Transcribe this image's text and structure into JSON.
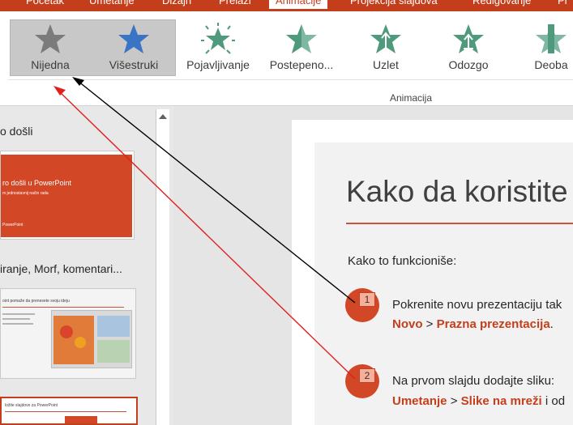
{
  "ribbon": {
    "tabs": [
      "Početak",
      "Umetanje",
      "Dizajn",
      "Prelazi",
      "Animacije",
      "Projekcija slajdova",
      "Redigovanje",
      "Pr"
    ],
    "active_tab": "Animacije",
    "gallery": [
      {
        "label": "Nijedna",
        "icon": "star-none-icon"
      },
      {
        "label": "Višestruki",
        "icon": "star-multiple-icon"
      },
      {
        "label": "Pojavljivanje",
        "icon": "star-appear-icon"
      },
      {
        "label": "Postepeno...",
        "icon": "star-fade-icon"
      },
      {
        "label": "Uzlet",
        "icon": "star-fly-in-icon"
      },
      {
        "label": "Odozgo",
        "icon": "star-float-in-icon"
      },
      {
        "label": "Deoba",
        "icon": "star-split-icon"
      }
    ],
    "group_label": "Animacija"
  },
  "slides_pane": {
    "sections": [
      {
        "title": "o došli"
      },
      {
        "title": "iranje, Morf, komentari..."
      }
    ],
    "thumb1": {
      "title": "ro došli u PowerPoint",
      "subtitle": "m jednostavnij način rada",
      "footer": "PowerPoint"
    },
    "thumb2": {
      "title": "oint pomaže da prenesete svoju ideju"
    },
    "thumb3": {
      "title": "ložite slajdove za PowerPoint"
    }
  },
  "slide": {
    "heading": "Kako da koristite o",
    "intro": "Kako to funkcioniše:",
    "step1": {
      "badge": "1",
      "line1": "Pokrenite novu prezentaciju tak",
      "link1": "Novo",
      "sep": " > ",
      "link2": "Prazna prezentacija",
      "end": "."
    },
    "step2": {
      "badge": "2",
      "line1": "Na prvom slajdu dodajte sliku:",
      "link1": "Umetanje",
      "sep": " > ",
      "link2": "Slike na mreži",
      "end": " i od"
    }
  },
  "colors": {
    "accent": "#c43e1c",
    "step_circle": "#d24726",
    "arrow_black": "#000000",
    "arrow_red": "#e02020"
  }
}
